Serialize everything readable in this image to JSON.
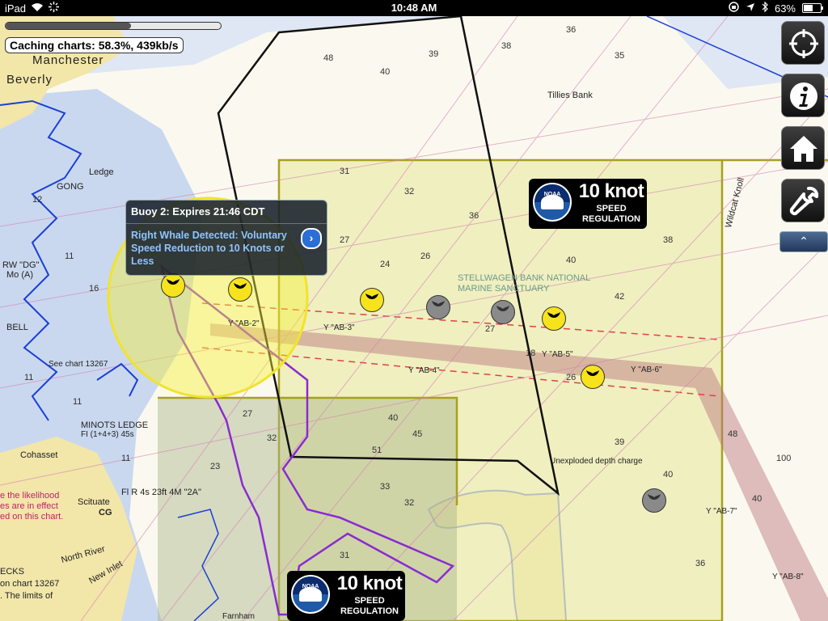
{
  "status_bar": {
    "device": "iPad",
    "time": "10:48 AM",
    "battery": "63%",
    "battery_level": 0.63
  },
  "caching": {
    "label": "Caching charts: 58.3%,  439kb/s",
    "progress": 0.583
  },
  "callout": {
    "title": "Buoy 2: Expires 21:46 CDT",
    "body": "Right Whale Detected: Voluntary Speed Reduction to 10 Knots or Less"
  },
  "speed_badges": [
    {
      "logo": "NOAA",
      "speed": "10 knot",
      "line1": "SPEED",
      "line2": "REGULATION"
    },
    {
      "logo": "NOAA",
      "speed": "10 knot",
      "line1": "SPEED",
      "line2": "REGULATION"
    }
  ],
  "toolbar": {
    "icons": [
      "crosshair-icon",
      "info-icon",
      "home-icon",
      "wrench-icon",
      "chevron-up-icon"
    ],
    "collapse_glyph": "⌃"
  },
  "map_labels": {
    "manchester": "Manchester",
    "beverly": "Beverly",
    "gong": "GONG",
    "ledge": "Ledge",
    "minots_ledge": "MINOTS LEDGE",
    "horn": "FI (1+4+3) 45s",
    "cohasset": "Cohasset",
    "scituate": "Scituate",
    "north_river": "North River",
    "new_inlet": "New Inlet",
    "tillies_bank": "Tillies Bank",
    "stellwagen_sanctuary": "STELLWAGEN BANK NATIONAL MARINE SANCTUARY",
    "unexploded": "Unexploded depth charge",
    "wildcat_knoll": "Wildcat Knoll",
    "see_chart": "See chart 13267",
    "likelihood": "e the likelihood",
    "effect": "es are in effect",
    "on_chart": "ed on this chart.",
    "becks": "ECKS",
    "on_chart_13267": "on chart 13267",
    "limits_of": ". The limits of",
    "farnham": "Farnham",
    "rw_dg": "RW \"DG\"",
    "mo_a": "Mo (A)",
    "bell": "BELL",
    "fl_r": "Fl R 4s 23ft 4M \"2A\"",
    "cg": "CG",
    "ab2": "Y \"AB-2\"",
    "ab3": "Y \"AB-3\"",
    "ab4": "Y \"AB-4\"",
    "ab5": "Y \"AB-5\"",
    "ab6": "Y \"AB-6\"",
    "ab7": "Y \"AB-7\"",
    "ab8": "Y \"AB-8\""
  },
  "colors": {
    "land": "#f2e6a9",
    "shallow": "#c9d8ef",
    "deep": "#fbf9ef",
    "sanctuary_fill": "#ecebb0",
    "sanctuary_border": "#a8a020",
    "shipping_lane": "#b9727c",
    "purple_area": "#8a2bd0",
    "coast_blue": "#1a3fd6"
  }
}
